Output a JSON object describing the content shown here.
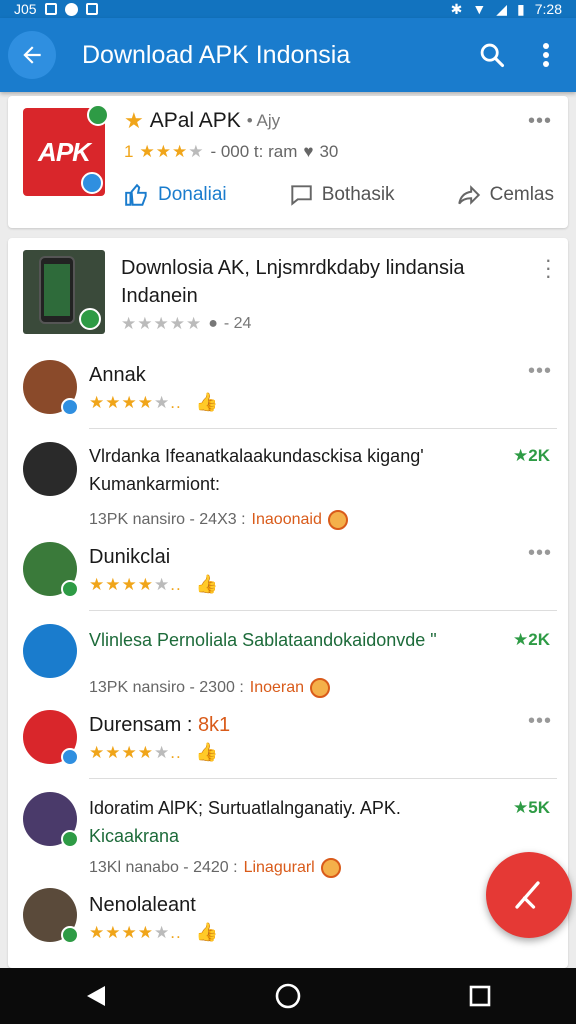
{
  "status_bar": {
    "time": "7:28",
    "left": "J05"
  },
  "app_bar": {
    "title": "Download APK Indonsia"
  },
  "top_app": {
    "icon_text": "APK",
    "name": "APal APK",
    "sub": "• Ajy",
    "rating_number": "1",
    "rating_meta": "- 000 t: ram",
    "comment_count": "30",
    "actions": {
      "download": "Donaliai",
      "share": "Bothasik",
      "compare": "Cemlas"
    }
  },
  "list_header": {
    "title": "Downlosia AK, Lnjsmrdkdaby lindansia Indanein",
    "meta": "- 24",
    "more": "⋮"
  },
  "reviews": [
    {
      "name": "Annak",
      "avatar_color": "#8a4a2a"
    },
    {
      "name": "Dunikclai",
      "avatar_color": "#3a7a3a"
    },
    {
      "name": "Durensam :",
      "name_accent": "8k1",
      "avatar_color": "#d9262b"
    },
    {
      "name": "Nenolaleant",
      "avatar_color": "#5a4a3a"
    }
  ],
  "comments": [
    {
      "title": "Vlrdanka Ifeanatkalaakundasckisa kigang' Kumankarmiont:",
      "count": "2K",
      "meta_a": "13PK nansiro - 24X3 :",
      "meta_tag": "Inaoonaid"
    },
    {
      "title": "Vlinlesa Pernoliala Sablataandokaidonvde \"",
      "count": "2K",
      "meta_a": "13PK nansiro - 2300 :",
      "meta_tag": "Inoeran"
    },
    {
      "title": "Idoratim AlPK; Surtuatlalnganatiy. APK.",
      "title_accent": "Kicaakrana",
      "count": "5K",
      "meta_a": "13Kl nanabo - 2420 :",
      "meta_tag": "Linagurarl"
    }
  ],
  "colors": {
    "primary": "#1a7ccd",
    "accent": "#e53935",
    "star": "#f0a51a",
    "green": "#2e9b45"
  }
}
